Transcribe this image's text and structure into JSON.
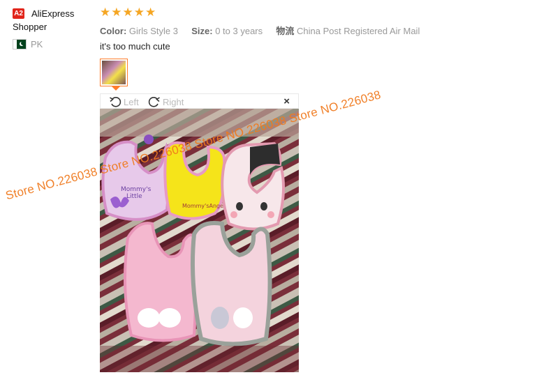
{
  "reviewer": {
    "avatar_text": "A2",
    "name_line1": "AliExpress",
    "name_line2": "Shopper",
    "country_code": "PK",
    "flag_icon": "pakistan-flag-icon"
  },
  "review": {
    "rating": 5,
    "rating_stars": "★★★★★",
    "color_label": "Color:",
    "color_value": "Girls Style 3",
    "size_label": "Size:",
    "size_value": "0 to 3 years",
    "shipping_label": "物流",
    "shipping_value": "China Post Registered Air Mail",
    "text": "it's too much cute"
  },
  "viewer": {
    "rotate_left_label": "Left",
    "rotate_right_label": "Right",
    "close_symbol": "×"
  },
  "watermark": {
    "text": "Store NO.226038 Store NO.226038 Store NO.226038 Store NO.226038"
  },
  "colors": {
    "accent": "#ff7d2c",
    "star": "#f5a623",
    "avatar_bg": "#e1251b",
    "watermark": "#f07a1e"
  }
}
